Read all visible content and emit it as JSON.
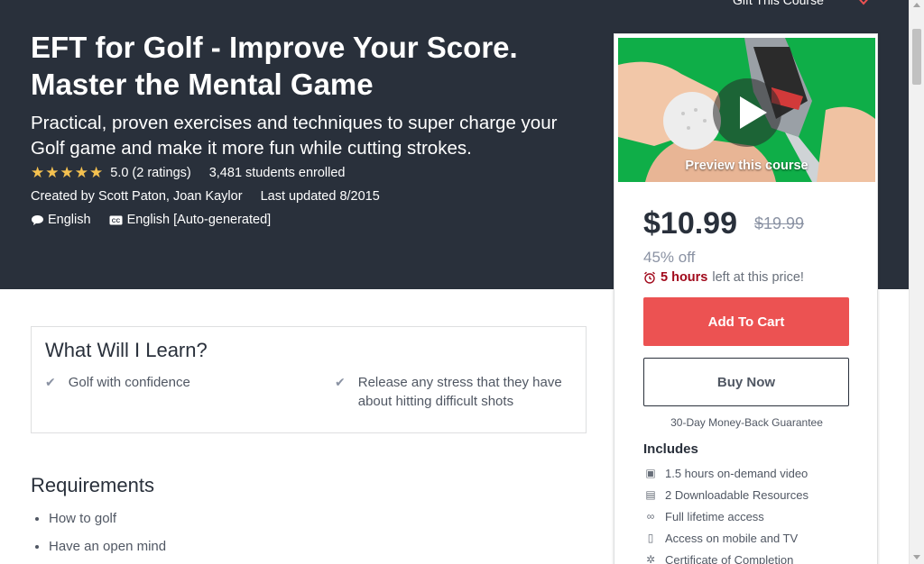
{
  "hero": {
    "top_cut_text": "Gift This Course",
    "title": "EFT for Golf - Improve Your Score. Master the Mental Game",
    "subtitle": "Practical, proven exercises and techniques to super charge your Golf game and make it more fun while cutting strokes.",
    "rating": "5.0 (2 ratings)",
    "stars": 5,
    "enrolled": "3,481 students enrolled",
    "created_by": "Created by Scott Paton, Joan Kaylor",
    "last_updated": "Last updated 8/2015",
    "language": "English",
    "captions": "English [Auto-generated]"
  },
  "sidebar": {
    "preview_label": "Preview this course",
    "price": "$10.99",
    "old_price": "$19.99",
    "discount": "45% off",
    "timer_bold": "5 hours",
    "timer_rest": "left at this price!",
    "add_to_cart": "Add To Cart",
    "buy_now": "Buy Now",
    "guarantee": "30-Day Money-Back Guarantee",
    "includes_heading": "Includes",
    "includes": [
      {
        "icon": "video-icon",
        "label": "1.5 hours on-demand video"
      },
      {
        "icon": "file-icon",
        "label": "2 Downloadable Resources"
      },
      {
        "icon": "infinity-icon",
        "label": "Full lifetime access"
      },
      {
        "icon": "mobile-icon",
        "label": "Access on mobile and TV"
      },
      {
        "icon": "certificate-icon",
        "label": "Certificate of Completion"
      }
    ]
  },
  "learn": {
    "title": "What Will I Learn?",
    "items": [
      "Golf with confidence",
      "Release any stress that they have about hitting difficult shots"
    ]
  },
  "requirements": {
    "title": "Requirements",
    "items": [
      "How to golf",
      "Have an open mind"
    ]
  },
  "colors": {
    "hero_bg": "#29303b",
    "accent_red": "#ec5252",
    "star": "#f4c150",
    "timer_red": "#a1091b"
  }
}
